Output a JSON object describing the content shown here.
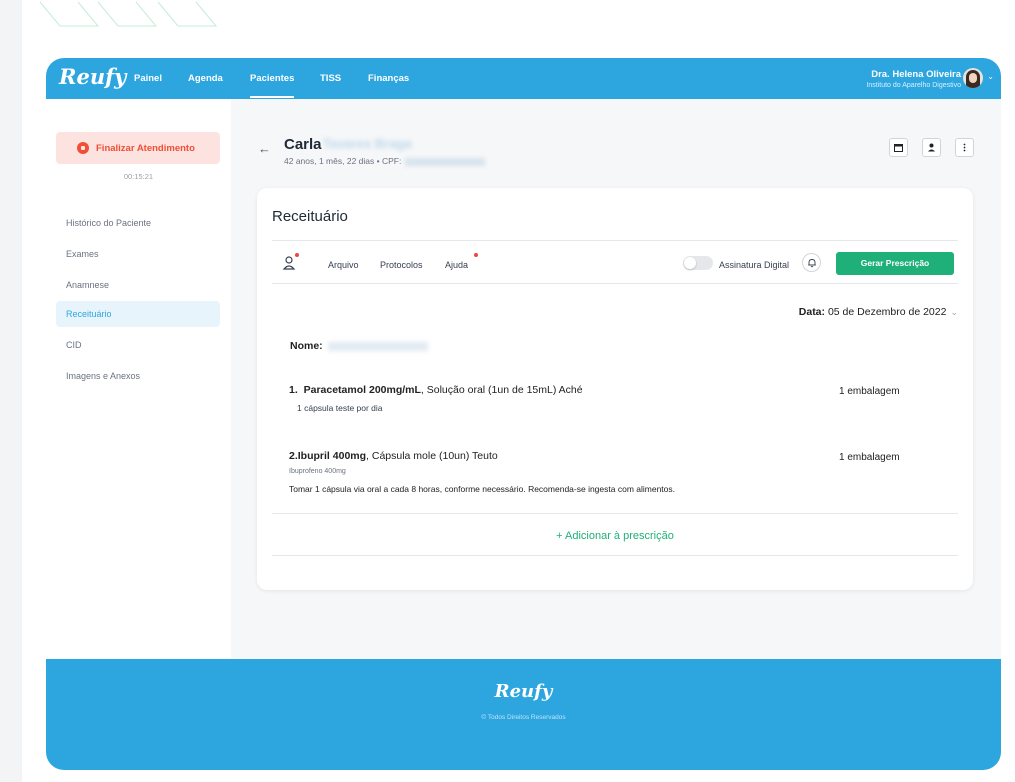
{
  "colors": {
    "brand": "#2da6e0",
    "accent_green": "#1fb07a",
    "danger": "#f04e37"
  },
  "nav": {
    "logo": "Reufy",
    "items": [
      "Painel",
      "Agenda",
      "Pacientes",
      "TISS",
      "Finanças"
    ],
    "active": "Pacientes",
    "user_name": "Dra. Helena Oliveira",
    "user_institution": "Instituto do Aparelho Digestivo"
  },
  "sidebar": {
    "finalizar_label": "Finalizar Atendimento",
    "timer": "00:15:21",
    "items": [
      "Histórico do Paciente",
      "Exames",
      "Anamnese",
      "Receituário",
      "CID",
      "Imagens e Anexos"
    ],
    "active": "Receituário"
  },
  "patient": {
    "first_name": "Carla",
    "last_name": "Tavares Braga",
    "meta": "42 anos, 1 mês, 22 dias • CPF:"
  },
  "card": {
    "title": "Receituário",
    "toolbar": {
      "arquivo": "Arquivo",
      "protocolos": "Protocolos",
      "ajuda": "Ajuda",
      "assinatura": "Assinatura Digital",
      "gerar": "Gerar Prescrição"
    },
    "data_label": "Data:",
    "data_value": "05 de Dezembro de 2022",
    "nome_label": "Nome:",
    "meds": [
      {
        "index": "1.",
        "name": "Paracetamol 200mg/mL",
        "desc": ", Solução oral (1un de 15mL) Aché",
        "posology": "1 cápsula teste por dia",
        "qty": "1 embalagem"
      },
      {
        "index": "2.",
        "name": "Ibupril 400mg",
        "desc": ", Cápsula mole (10un) Teuto",
        "generic": "Ibuprofeno 400mg",
        "posology": "Tomar 1 cápsula via oral a cada 8 horas, conforme necessário. Recomenda-se ingesta com alimentos.",
        "qty": "1 embalagem"
      }
    ],
    "add_label": "+ Adicionar à prescrição"
  },
  "footer": {
    "logo": "Reufy",
    "copyright": "© Todos Direitos Reservados"
  }
}
